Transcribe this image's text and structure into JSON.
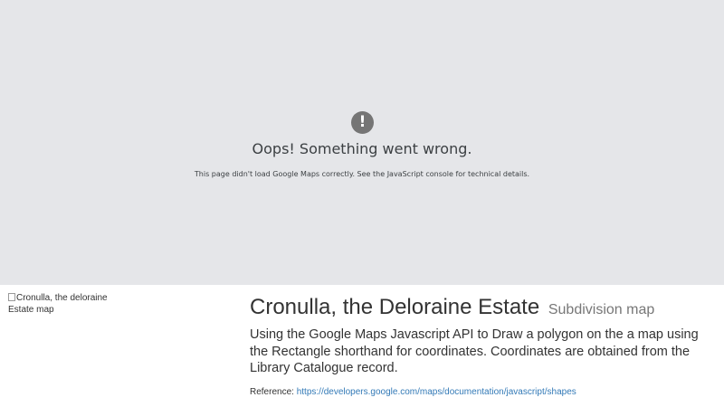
{
  "map_error": {
    "icon": "exclamation-icon",
    "icon_glyph": "!",
    "title": "Oops! Something went wrong.",
    "detail": "This page didn't load Google Maps correctly. See the JavaScript console for technical details."
  },
  "image": {
    "alt": "Cronulla, the deloraine Estate map"
  },
  "content": {
    "title": "Cronulla, the Deloraine Estate",
    "subtitle": "Subdivision map",
    "lead": "Using the Google Maps Javascript API to Draw a polygon on the a map using the Rectangle shorthand for coordinates. Coordinates are obtained from the Library Catalogue record.",
    "reference_label": "Reference:",
    "reference_url": "https://developers.google.com/maps/documentation/javascript/shapes"
  },
  "colors": {
    "map_background": "#e5e6e9",
    "link": "#337ab7"
  }
}
